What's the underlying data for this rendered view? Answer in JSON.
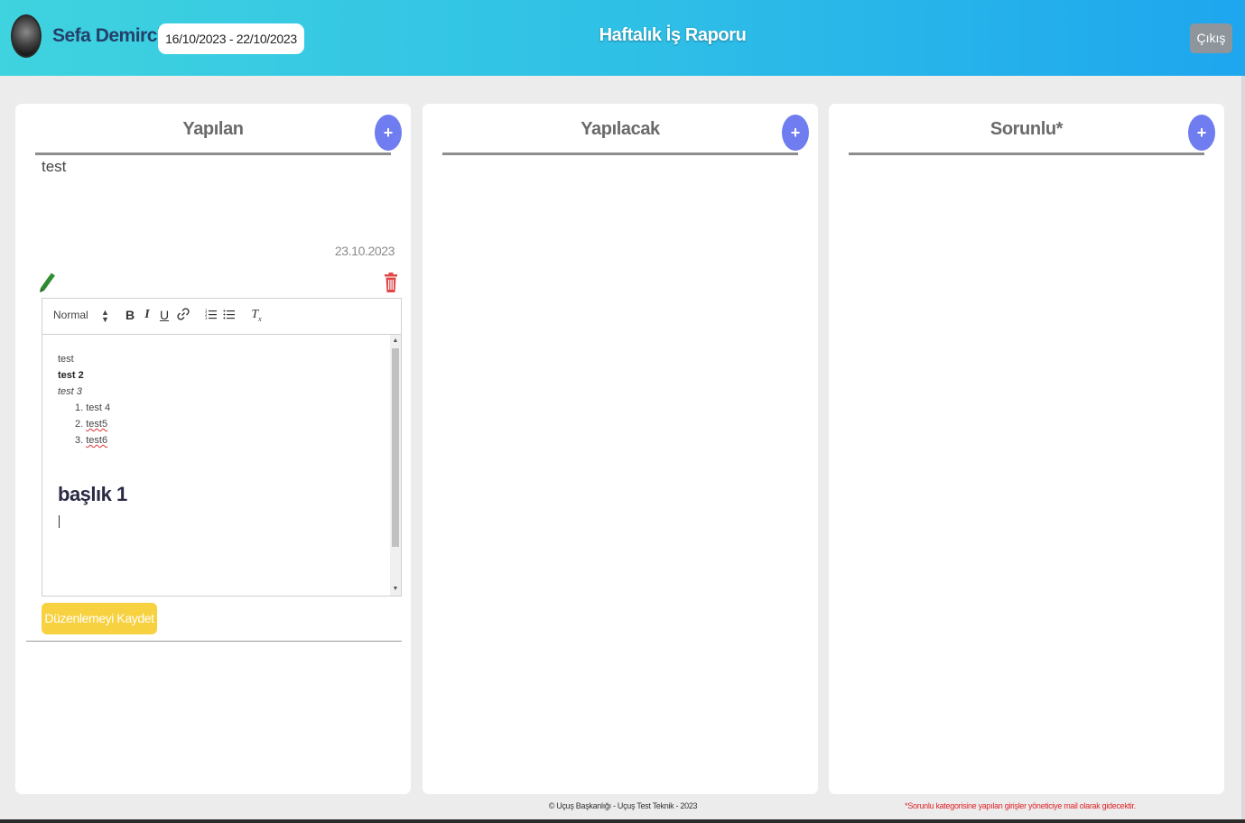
{
  "header": {
    "user_name": "Sefa Demirci",
    "date_range": "16/10/2023 - 22/10/2023",
    "title": "Haftalık İş Raporu",
    "logout_label": "Çıkış"
  },
  "columns": [
    {
      "title": "Yapılan",
      "add_label": "+"
    },
    {
      "title": "Yapılacak",
      "add_label": "+"
    },
    {
      "title": "Sorunlu*",
      "add_label": "+"
    }
  ],
  "entry": {
    "text": "test",
    "date": "23.10.2023"
  },
  "editor": {
    "format_select": "Normal",
    "toolbar": {
      "bold": "B",
      "italic": "I",
      "underline": "U",
      "clear": "Tx"
    },
    "content": {
      "line1": "test",
      "line2": "test 2",
      "line3": "test 3",
      "list": [
        "1. test 4",
        "2. test5",
        "3. test6"
      ],
      "heading": "başlık 1"
    }
  },
  "save_label": "Düzenlemeyi Kaydet",
  "footer": {
    "copyright": "© Uçuş Başkanlığı - Uçuş Test Teknik - 2023",
    "note": "*Sorunlu kategorisine yapılan girişler yöneticiye mail olarak gidecektir."
  },
  "colors": {
    "header_gradient_start": "#3fd3df",
    "header_gradient_end": "#1ea6ee",
    "add_button": "#6f7df0",
    "save_button": "#f7d13f",
    "delete_icon": "#e04848",
    "edit_icon": "#2e8b2e",
    "footer_note": "#e0262c"
  },
  "icons": {
    "edit": "pencil-icon",
    "delete": "trash-icon",
    "link": "link-icon",
    "ordered_list": "ordered-list-icon",
    "bullet_list": "bullet-list-icon"
  }
}
